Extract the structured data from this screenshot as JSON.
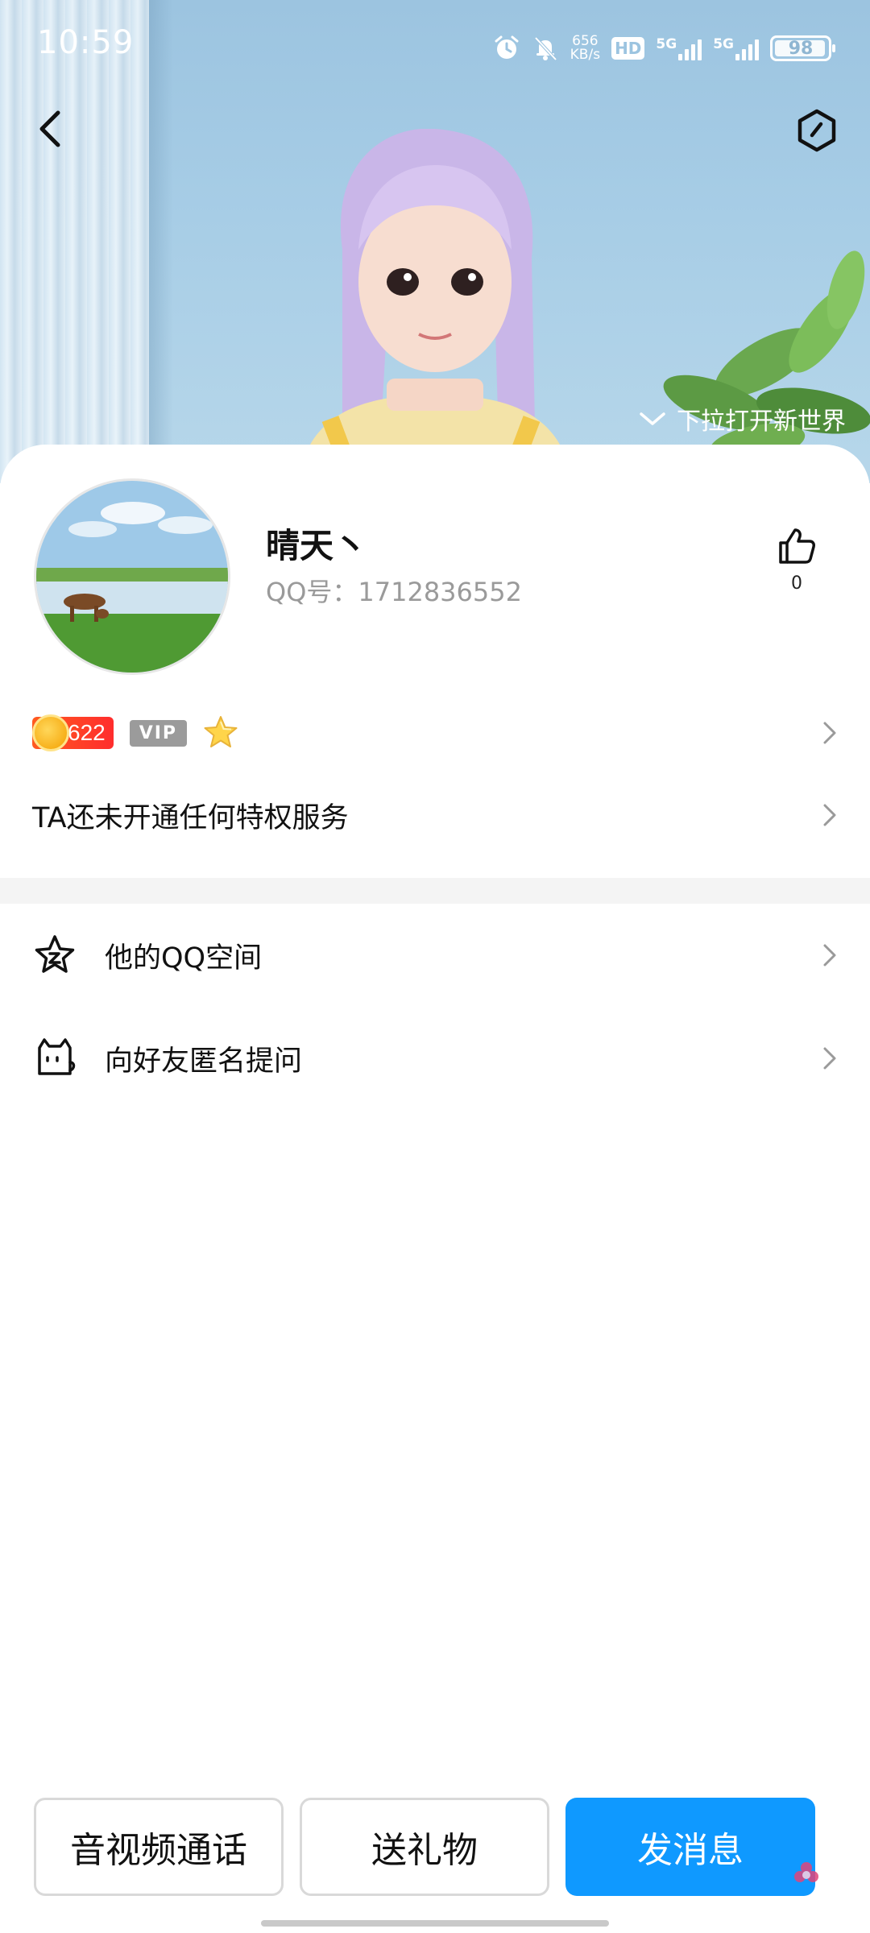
{
  "status_bar": {
    "time": "10:59",
    "net_speed_value": "656",
    "net_speed_unit": "KB/s",
    "hd_label": "HD",
    "signal_1_label": "5G",
    "signal_2_label": "5G",
    "battery": "98"
  },
  "header": {
    "pull_hint": "下拉打开新世界"
  },
  "profile": {
    "nickname": "晴天丶",
    "qq_number": "QQ号：1712836552",
    "like_count": "0",
    "level": "622",
    "vip_label": "VIP"
  },
  "privilege": {
    "text": "TA还未开通任何特权服务"
  },
  "menu": {
    "items": [
      {
        "label": "他的QQ空间",
        "icon": "star-space-icon"
      },
      {
        "label": "向好友匿名提问",
        "icon": "cat-question-icon"
      }
    ]
  },
  "actions": {
    "call_label": "音视频通话",
    "gift_label": "送礼物",
    "message_label": "发消息"
  },
  "colors": {
    "accent": "#0f99ff",
    "level_badge": "#ff3b24",
    "vip_grey": "#9b9b9b"
  }
}
